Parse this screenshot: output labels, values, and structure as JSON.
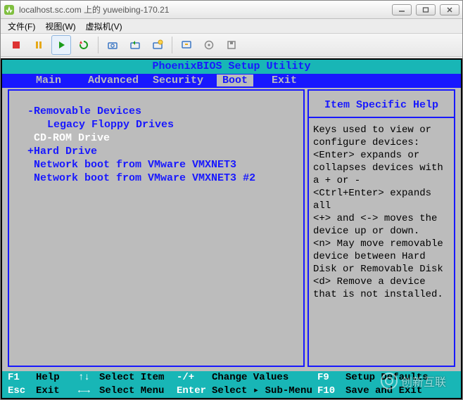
{
  "window": {
    "title": "localhost.sc.com 上的 yuweibing-170.21"
  },
  "menubar": {
    "file": "文件(F)",
    "view": "视图(W)",
    "vm": "虚拟机(V)"
  },
  "bios": {
    "title": "PhoenixBIOS Setup Utility",
    "tabs": {
      "main": "Main",
      "advanced": "Advanced",
      "security": "Security",
      "boot": "Boot",
      "exit": "Exit"
    },
    "boot_items": {
      "removable": "-Removable Devices",
      "legacy": "Legacy Floppy Drives",
      "cdrom": "CD-ROM Drive",
      "hard": "+Hard Drive",
      "net1": "Network boot from VMware VMXNET3",
      "net2": "Network boot from VMware VMXNET3 #2"
    },
    "help": {
      "title": "Item Specific Help",
      "body": "Keys used to view or\nconfigure devices:\n<Enter> expands or\ncollapses devices with\na + or -\n<Ctrl+Enter> expands\nall\n<+> and <-> moves the\ndevice up or down.\n<n> May move removable\ndevice between Hard\nDisk or Removable Disk\n<d> Remove a device\nthat is not installed."
    },
    "footer": {
      "f1_key": "F1",
      "f1_label": "Help",
      "arrows_key": "↑↓",
      "arrows_label": "Select Item",
      "pm_key": "-/+",
      "pm_label": "Change Values",
      "f9_key": "F9",
      "f9_label": "Setup Defaults",
      "esc_key": "Esc",
      "esc_label": "Exit",
      "lr_key": "←→",
      "lr_label": "Select Menu",
      "enter_key": "Enter",
      "enter_label": "Select ▸ Sub-Menu",
      "f10_key": "F10",
      "f10_label": "Save and Exit"
    }
  },
  "watermark": "创新互联"
}
